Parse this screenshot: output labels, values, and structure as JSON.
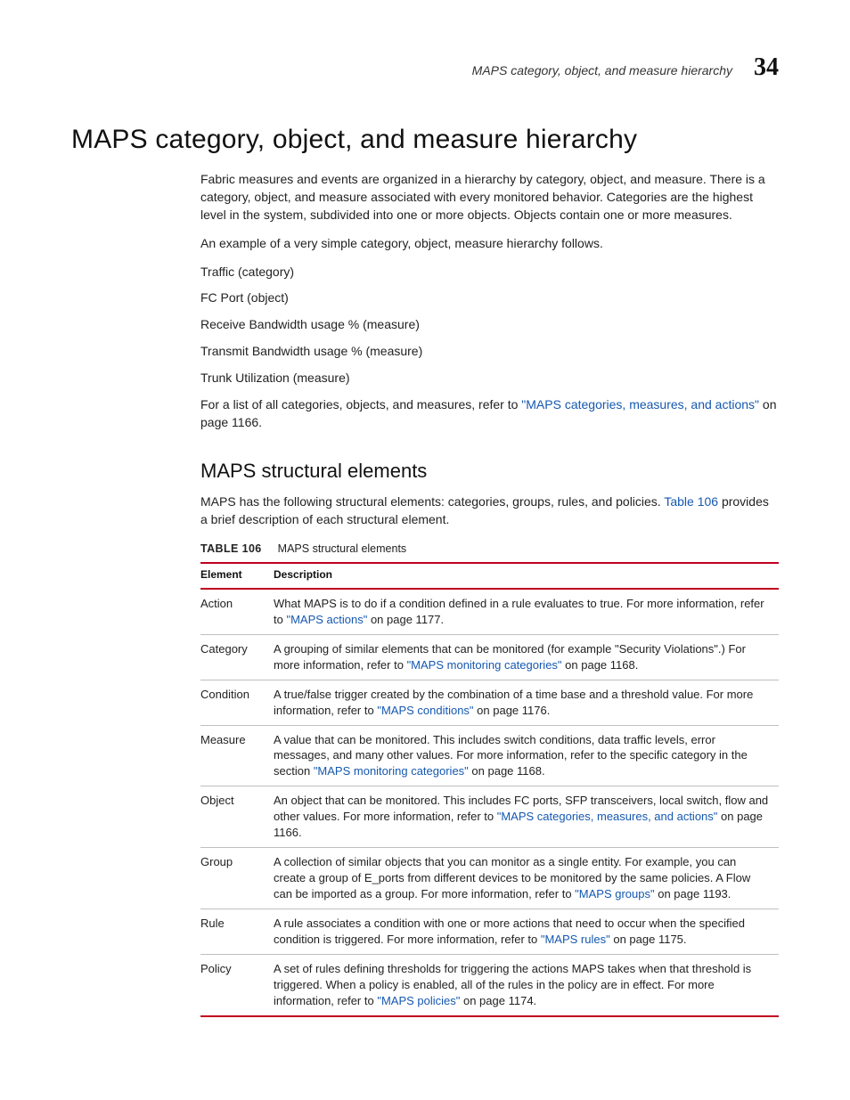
{
  "header": {
    "running_title": "MAPS category, object, and measure hierarchy",
    "chapter_number": "34"
  },
  "h1": "MAPS category, object, and measure hierarchy",
  "intro_para": "Fabric measures and events are organized in a hierarchy by category, object, and measure. There is a category, object, and measure associated with every monitored behavior. Categories are the highest level in the system, subdivided into one or more objects. Objects contain one or more measures.",
  "example_intro": "An example of a very simple category, object, measure hierarchy follows.",
  "hierarchy": {
    "l1": "Traffic (category)",
    "l2": "FC Port (object)",
    "l3a": "Receive Bandwidth usage % (measure)",
    "l3b": "Transmit Bandwidth usage % (measure)",
    "l3c": "Trunk Utilization (measure)"
  },
  "xref_line": {
    "prefix": "For a list of all categories, objects, and measures, refer to ",
    "link": "\"MAPS categories, measures, and actions\"",
    "suffix": " on page 1166."
  },
  "h2": "MAPS structural elements",
  "struct_intro": {
    "prefix": "MAPS has the following structural elements: categories, groups, rules, and policies. ",
    "link": "Table 106",
    "suffix": " provides a brief description of each structural element."
  },
  "table": {
    "caption_label": "TABLE 106",
    "caption_title": "MAPS structural elements",
    "col1": "Element",
    "col2": "Description",
    "rows": [
      {
        "el": "Action",
        "pre": "What MAPS is to do if a condition defined in a rule evaluates to true. For more information, refer to ",
        "link": "\"MAPS actions\"",
        "suf": " on page 1177."
      },
      {
        "el": "Category",
        "pre": "A grouping of similar elements that can be monitored (for example \"Security Violations\".) For more information, refer to ",
        "link": "\"MAPS monitoring categories\"",
        "suf": " on page 1168."
      },
      {
        "el": "Condition",
        "pre": "A true/false trigger created by the combination of a time base and a threshold value. For more information, refer to ",
        "link": "\"MAPS conditions\"",
        "suf": " on page 1176."
      },
      {
        "el": "Measure",
        "pre": "A value that can be monitored. This includes switch conditions, data traffic levels, error messages, and many other values. For more information, refer to the specific category in the section ",
        "link": "\"MAPS monitoring categories\"",
        "suf": " on page 1168."
      },
      {
        "el": "Object",
        "pre": "An object that can be monitored. This includes FC ports, SFP transceivers, local switch, flow and other values. For more information, refer to ",
        "link": "\"MAPS categories, measures, and actions\"",
        "suf": " on page 1166."
      },
      {
        "el": "Group",
        "pre": "A collection of similar objects that you can monitor as a single entity. For example, you can create a group of E_ports from different devices to be monitored by the same policies. A Flow can be imported as a group. For more information, refer to ",
        "link": "\"MAPS groups\"",
        "suf": " on page 1193."
      },
      {
        "el": "Rule",
        "pre": "A rule associates a condition with one or more actions that need to occur when the specified condition is triggered. For more information, refer to ",
        "link": "\"MAPS rules\"",
        "suf": " on page 1175."
      },
      {
        "el": "Policy",
        "pre": "A set of rules defining thresholds for triggering the actions MAPS takes when that threshold is triggered. When a policy is enabled, all of the rules in the policy are in effect. For more information, refer to ",
        "link": "\"MAPS policies\"",
        "suf": " on page 1174."
      }
    ]
  }
}
